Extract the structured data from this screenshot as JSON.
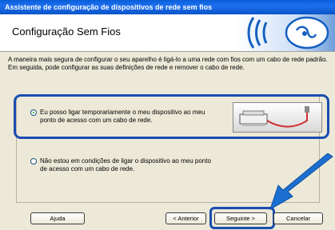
{
  "window": {
    "title": "Assistente de configuração de dispositivos de rede sem fios"
  },
  "header": {
    "title": "Configuração Sem Fios"
  },
  "intro": {
    "text": "A maneira mais segura de configurar o seu aparelho é ligá-lo a uma rede com fios com um cabo de rede padrão. Em seguida, pode configurar as suas definições de rede e remover o cabo de rede."
  },
  "options": [
    {
      "label": "Eu posso ligar temporariamente o meu dispositivo ao meu ponto de acesso com um cabo de rede.",
      "selected": true
    },
    {
      "label": "Não estou em condições de ligar o dispositivo ao meu ponto de acesso com um cabo de rede.",
      "selected": false
    }
  ],
  "buttons": {
    "help": "Ajuda",
    "back": "< Anterior",
    "next": "Seguinte >",
    "cancel": "Cancelar"
  },
  "colors": {
    "titlebar": "#0a5fd8",
    "highlight": "#1a4db0",
    "logo_blue": "#1560c0",
    "arrow": "#1c6fd0",
    "cable": "#d03030"
  },
  "icons": {
    "logo": "wireless-signal-icon",
    "device": "printer-cable-icon",
    "pointer": "blue-arrow-icon"
  }
}
